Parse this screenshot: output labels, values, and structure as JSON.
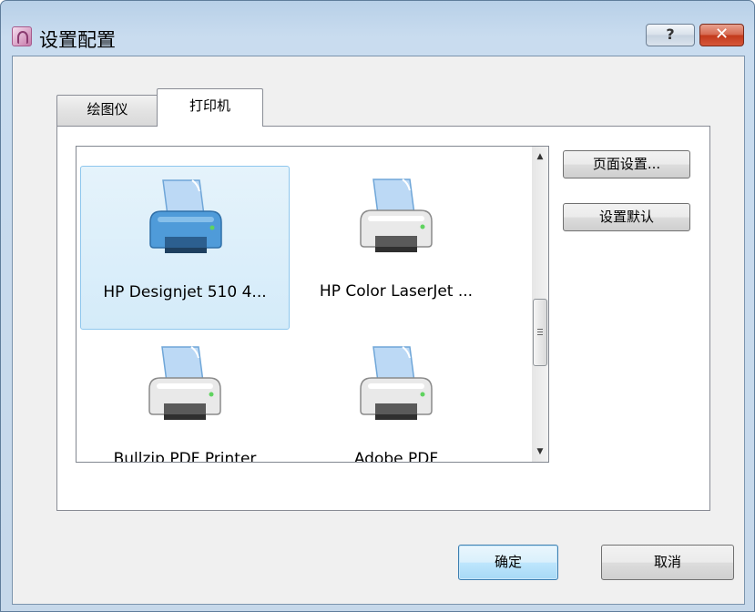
{
  "window": {
    "title": "设置配置",
    "help_label": "?",
    "close_label": "✕"
  },
  "tabs": [
    {
      "label": "绘图仪",
      "active": false
    },
    {
      "label": "打印机",
      "active": true
    }
  ],
  "printers": [
    {
      "label": "HP Designjet 510 4...",
      "selected": true
    },
    {
      "label": "HP Color LaserJet ...",
      "selected": false
    },
    {
      "label": "Bullzip PDF Printer",
      "selected": false
    },
    {
      "label": "Adobe PDF",
      "selected": false
    }
  ],
  "scrollbar": {
    "up_arrow": "▲",
    "down_arrow": "▼"
  },
  "side_buttons": {
    "page_setup": "页面设置...",
    "set_default": "设置默认"
  },
  "footer": {
    "ok": "确定",
    "cancel": "取消"
  },
  "colors": {
    "selection_bg": "#d4ebf9",
    "selection_border": "#8fc7ed",
    "default_button_border": "#3c7fb1",
    "close_button": "#c2391b"
  }
}
